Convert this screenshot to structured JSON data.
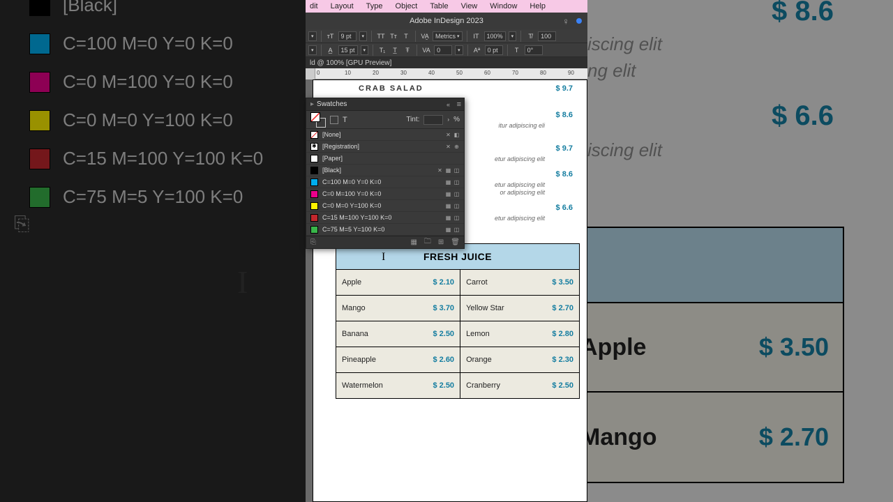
{
  "app": {
    "title": "Adobe InDesign 2023",
    "doc_tab": "ld @ 100% [GPU Preview]"
  },
  "menus": [
    "dit",
    "Layout",
    "Type",
    "Object",
    "Table",
    "View",
    "Window",
    "Help"
  ],
  "ctrlbar1": {
    "font_size": "9 pt",
    "kern": "Metrics",
    "zoom": "100%",
    "rot": "100"
  },
  "ctrlbar2": {
    "leading": "15 pt",
    "track": "0",
    "baseline": "0 pt",
    "skew": "0°"
  },
  "ruler": {
    "marks": [
      "0",
      "10",
      "20",
      "30",
      "40",
      "50",
      "60",
      "70",
      "80",
      "90"
    ]
  },
  "doc": {
    "heading": "CRAB SALAD",
    "lines": [
      "itur adipiscing eli",
      "etur adipiscing elit",
      "etur adipiscing elit",
      "or adipiscing elit",
      "etur adipiscing elit"
    ],
    "prices": [
      "$ 9.7",
      "$ 8.6",
      "$ 9.7",
      "$ 8.6",
      "$ 6.6"
    ]
  },
  "table": {
    "title": "FRESH JUICE",
    "rows": [
      {
        "a": "Apple",
        "ap": "$ 2.10",
        "b": "Carrot",
        "bp": "$ 3.50"
      },
      {
        "a": "Mango",
        "ap": "$ 3.70",
        "b": "Yellow Star",
        "bp": "$ 2.70"
      },
      {
        "a": "Banana",
        "ap": "$ 2.50",
        "b": "Lemon",
        "bp": "$ 2.80"
      },
      {
        "a": "Pineapple",
        "ap": "$ 2.60",
        "b": "Orange",
        "bp": "$ 2.30"
      },
      {
        "a": "Watermelon",
        "ap": "$ 2.50",
        "b": "Cranberry",
        "bp": "$ 2.50"
      }
    ]
  },
  "panel": {
    "title": "Swatches",
    "tint_label": "Tint:",
    "tint_pct": "%",
    "swatches": [
      {
        "name": "[None]",
        "color": "none",
        "lock": true,
        "nonedit": true
      },
      {
        "name": "[Registration]",
        "color": "reg",
        "lock": true,
        "reg": true
      },
      {
        "name": "[Paper]",
        "color": "#ffffff"
      },
      {
        "name": "[Black]",
        "color": "#000000",
        "lock": true,
        "proc": true
      },
      {
        "name": "C=100 M=0 Y=0 K=0",
        "color": "#00aeef",
        "proc": true
      },
      {
        "name": "C=0 M=100 Y=0 K=0",
        "color": "#ec008c",
        "proc": true
      },
      {
        "name": "C=0 M=0 Y=100 K=0",
        "color": "#fff200",
        "proc": true
      },
      {
        "name": "C=15 M=100 Y=100 K=0",
        "color": "#c1272d",
        "proc": true
      },
      {
        "name": "C=75 M=5 Y=100 K=0",
        "color": "#39b54a",
        "proc": true
      }
    ]
  },
  "bg_left": {
    "rows": [
      {
        "name": "[Black]",
        "color": "#000000"
      },
      {
        "name": "C=100 M=0 Y=0 K=0",
        "color": "#00aeef"
      },
      {
        "name": "C=0 M=100 Y=0 K=0",
        "color": "#ec008c"
      },
      {
        "name": "C=0 M=0 Y=100 K=0",
        "color": "#fff200"
      },
      {
        "name": "C=15 M=100 Y=100 K=0",
        "color": "#c1272d"
      },
      {
        "name": "C=75 M=5 Y=100 K=0",
        "color": "#39b54a"
      }
    ]
  },
  "bg_right": {
    "prices": [
      "$ 8.6",
      "$ 6.6"
    ],
    "texts": [
      "iscing elit",
      "ng elit",
      "iscing elit"
    ],
    "table": [
      {
        "name": "Apple",
        "price": "$ 3.50"
      },
      {
        "name": "Mango",
        "price": "$ 2.70"
      }
    ]
  }
}
